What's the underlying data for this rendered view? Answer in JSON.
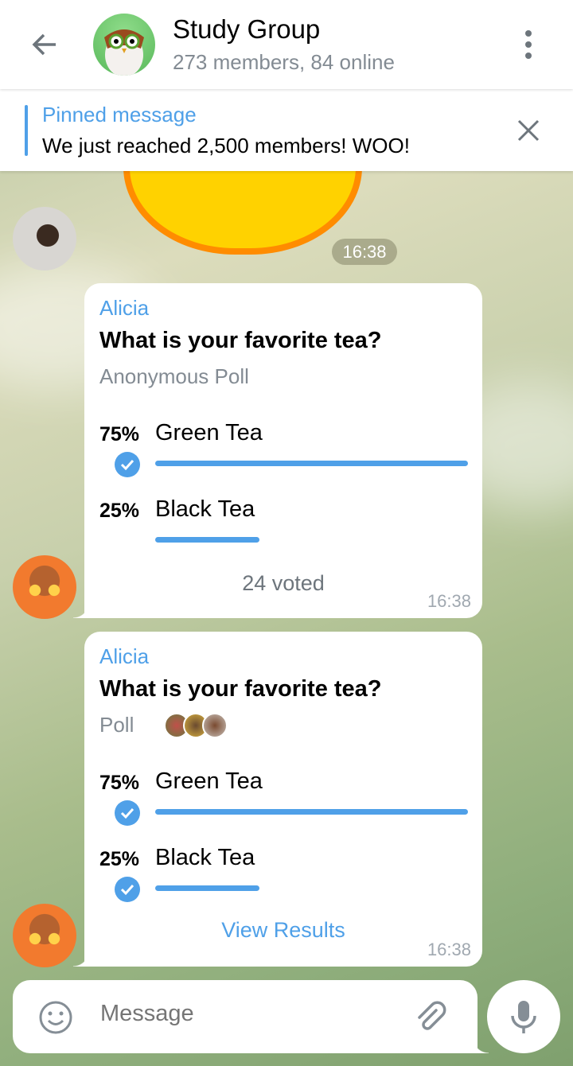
{
  "header": {
    "title": "Study Group",
    "subtitle": "273 members, 84 online"
  },
  "pinned": {
    "label": "Pinned message",
    "text": "We just reached 2,500 members! WOO!"
  },
  "sticker_time": "16:38",
  "messages": [
    {
      "sender": "Alicia",
      "question": "What is your favorite tea?",
      "type": "Anonymous Poll",
      "options": [
        {
          "pct": "75%",
          "value": 75,
          "label": "Green Tea",
          "checked": true
        },
        {
          "pct": "25%",
          "value": 25,
          "label": "Black Tea",
          "checked": false
        }
      ],
      "footer": "24 voted",
      "time": "16:38"
    },
    {
      "sender": "Alicia",
      "question": "What is your favorite tea?",
      "type": "Poll",
      "options": [
        {
          "pct": "75%",
          "value": 75,
          "label": "Green Tea",
          "checked": true
        },
        {
          "pct": "25%",
          "value": 25,
          "label": "Black Tea",
          "checked": true
        }
      ],
      "footer": "View Results",
      "time": "16:38"
    }
  ],
  "input": {
    "placeholder": "Message"
  },
  "colors": {
    "accent": "#4fa0e8"
  }
}
